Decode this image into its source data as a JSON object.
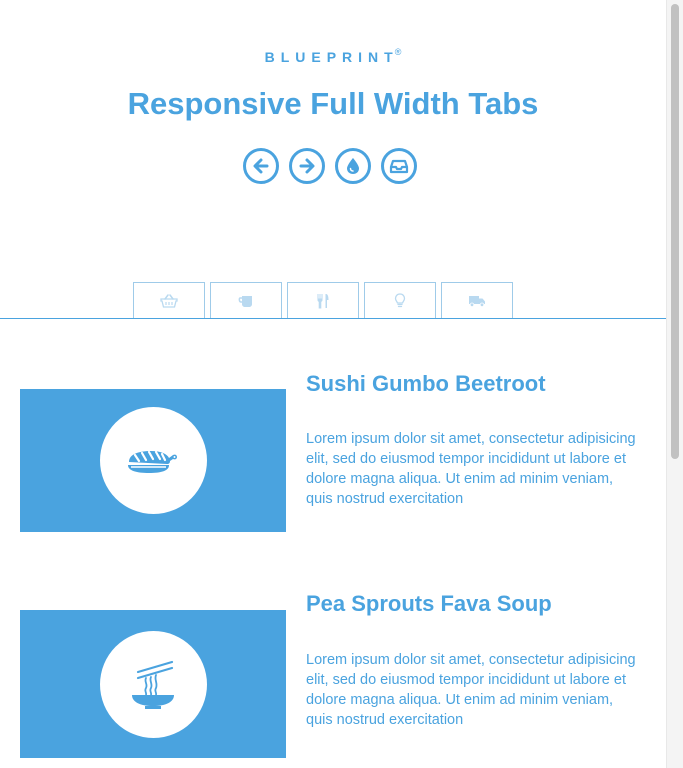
{
  "header": {
    "brand": "BLUEPRINT",
    "brand_mark": "®",
    "title": "Responsive Full Width Tabs"
  },
  "nav_icons": [
    {
      "icon": "arrow-left-icon",
      "label": "Previous"
    },
    {
      "icon": "arrow-right-icon",
      "label": "Next"
    },
    {
      "icon": "drop-icon",
      "label": "Drop"
    },
    {
      "icon": "inbox-icon",
      "label": "Inbox"
    }
  ],
  "tabs": [
    {
      "icon": "basket-icon",
      "selected": false
    },
    {
      "icon": "coffee-icon",
      "selected": false
    },
    {
      "icon": "cutlery-icon",
      "selected": false
    },
    {
      "icon": "lightbulb-icon",
      "selected": false
    },
    {
      "icon": "truck-icon",
      "selected": false
    }
  ],
  "items": [
    {
      "title": "Sushi Gumbo Beetroot",
      "text": "Lorem ipsum dolor sit amet, consectetur adipisicing elit, sed do eiusmod tempor incididunt ut labore et dolore magna aliqua. Ut enim ad minim veniam, quis nostrud exercitation",
      "icon": "sushi-icon"
    },
    {
      "title": "Pea Sprouts Fava Soup",
      "text": "Lorem ipsum dolor sit amet, consectetur adipisicing elit, sed do eiusmod tempor incididunt ut labore et dolore magna aliqua. Ut enim ad minim veniam, quis nostrud exercitation",
      "icon": "noodle-bowl-icon"
    }
  ],
  "colors": {
    "accent": "#4aa3df",
    "tab_border": "#9fcbe9",
    "tab_icon": "#b9d9f0"
  }
}
